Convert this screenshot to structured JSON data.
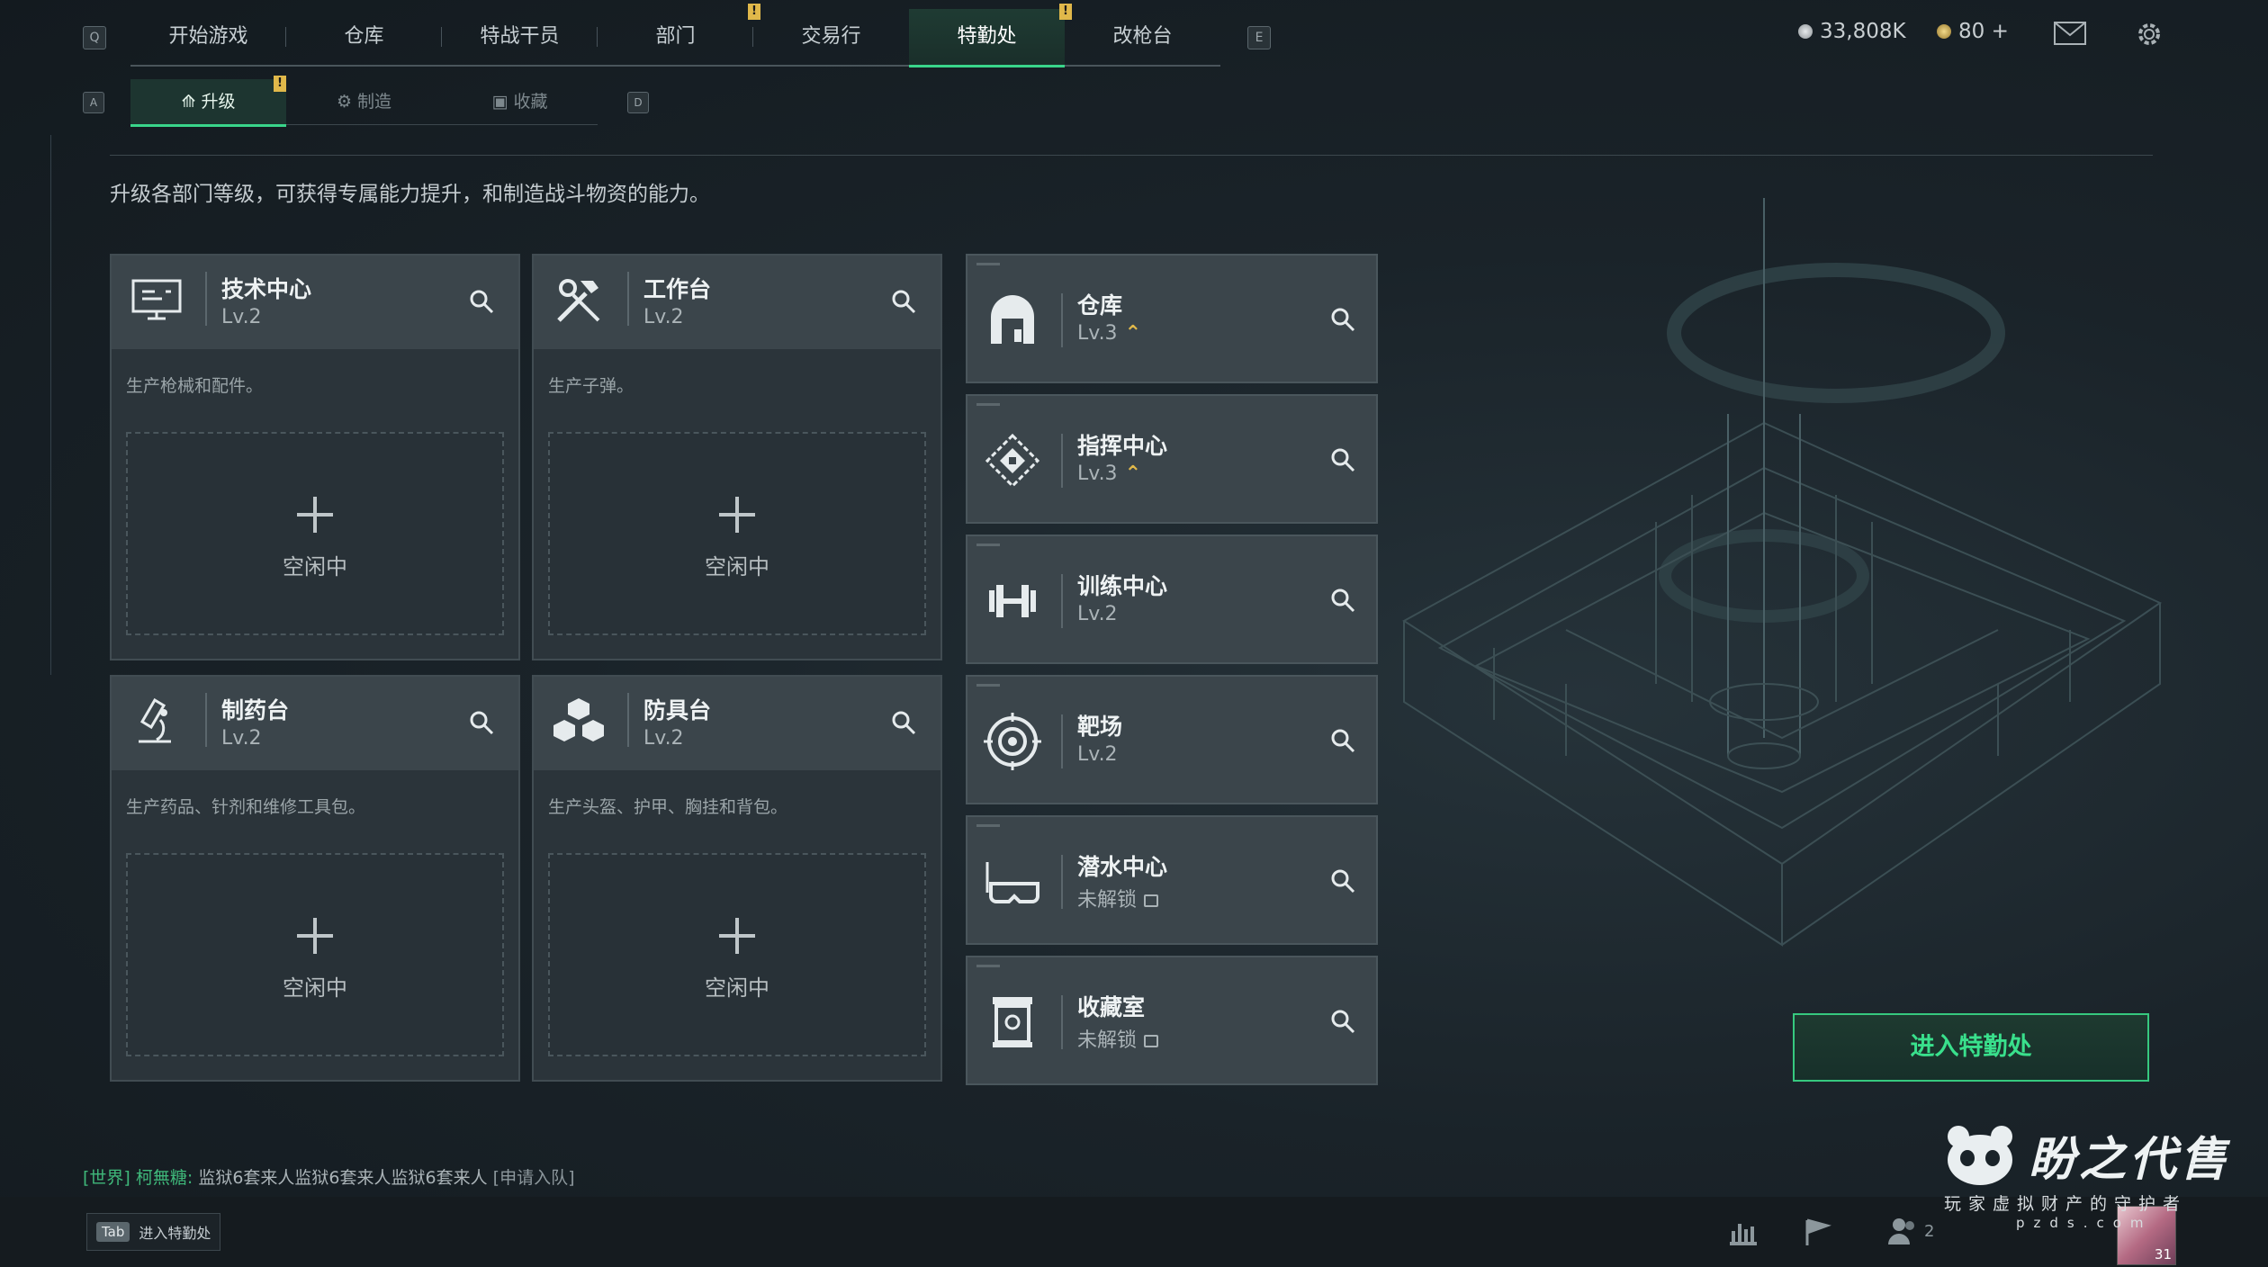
{
  "nav": {
    "left_key": "Q",
    "right_key": "E",
    "tabs": [
      "开始游戏",
      "仓库",
      "特战干员",
      "部门",
      "交易行",
      "特勤处",
      "改枪台"
    ],
    "active_index": 5
  },
  "subnav": {
    "left_key": "A",
    "right_key": "D",
    "tabs": [
      "升级",
      "制造",
      "收藏"
    ]
  },
  "currency": {
    "coins": "33,808K",
    "tickets": "80 +"
  },
  "description": "升级各部门等级，可获得专属能力提升，和制造战斗物资的能力。",
  "stations": [
    {
      "name": "技术中心",
      "level": "Lv.2",
      "desc": "生产枪械和配件。",
      "slot": "空闲中",
      "icon": "monitor-icon"
    },
    {
      "name": "工作台",
      "level": "Lv.2",
      "desc": "生产子弹。",
      "slot": "空闲中",
      "icon": "tools-icon"
    },
    {
      "name": "制药台",
      "level": "Lv.2",
      "desc": "生产药品、针剂和维修工具包。",
      "slot": "空闲中",
      "icon": "microscope-icon"
    },
    {
      "name": "防具台",
      "level": "Lv.2",
      "desc": "生产头盔、护甲、胸挂和背包。",
      "slot": "空闲中",
      "icon": "cubes-icon"
    }
  ],
  "departments": [
    {
      "name": "仓库",
      "level": "Lv.3",
      "upgradable": true,
      "icon": "warehouse-icon"
    },
    {
      "name": "指挥中心",
      "level": "Lv.3",
      "upgradable": true,
      "icon": "command-icon"
    },
    {
      "name": "训练中心",
      "level": "Lv.2",
      "upgradable": false,
      "icon": "dumbbell-icon"
    },
    {
      "name": "靶场",
      "level": "Lv.2",
      "upgradable": false,
      "icon": "target-icon"
    },
    {
      "name": "潜水中心",
      "level": "未解锁",
      "locked": true,
      "icon": "diving-mask-icon"
    },
    {
      "name": "收藏室",
      "level": "未解锁",
      "locked": true,
      "icon": "trophy-case-icon"
    }
  ],
  "enter_button": "进入特勤处",
  "chat": {
    "channel": "[世界]",
    "user": "柯無糖:",
    "message": "监狱6套来人监狱6套来人监狱6套来人",
    "action": "[申请入队]"
  },
  "footer": {
    "tab_key": "Tab",
    "tab_hint": "进入特勤处",
    "friends_count": "2",
    "avatar_level": "31"
  },
  "watermark": {
    "brand": "盼之代售",
    "slogan": "玩家虚拟财产的守护者",
    "url": "pzds.com"
  },
  "colors": {
    "accent": "#39d58a",
    "upgrade": "#e0b84a",
    "notify": "#e0b84a"
  }
}
